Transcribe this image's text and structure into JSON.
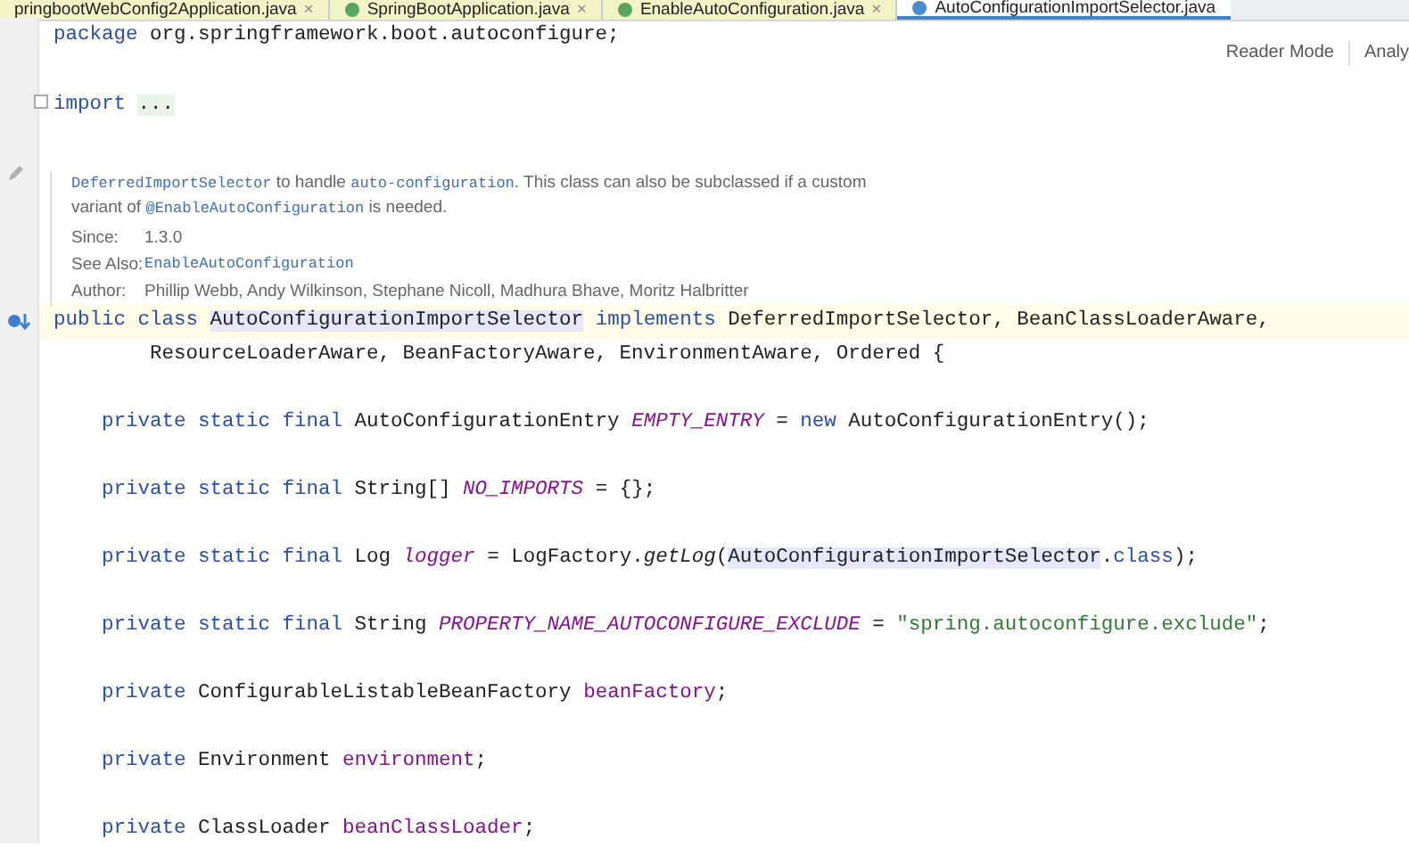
{
  "tabs": [
    {
      "label": "pringbootWebConfig2Application.java",
      "selected": false,
      "close": "×"
    },
    {
      "label": "SpringBootApplication.java",
      "selected": false,
      "close": "×"
    },
    {
      "label": "EnableAutoConfiguration.java",
      "selected": false,
      "close": "×"
    },
    {
      "label": "AutoConfigurationImportSelector.java",
      "selected": true
    }
  ],
  "toolbar": [
    "Reader Mode",
    "Analy"
  ],
  "package_line": [
    {
      "text": "package",
      "kind": "kw"
    },
    {
      "text": " org.springframework.boot.autoconfigure;",
      "kind": "plain"
    }
  ],
  "import_line": [
    {
      "text": "import ",
      "kind": "kw"
    },
    {
      "text": "...",
      "kind": "folded"
    }
  ],
  "javadoc": {
    "summary": [
      {
        "text": "DeferredImportSelector",
        "kind": "code"
      },
      {
        "text": " to handle ",
        "kind": "prose"
      },
      {
        "text": "auto-configuration",
        "kind": "code"
      },
      {
        "text": ". This class can also be subclassed if a custom variant of ",
        "kind": "prose"
      },
      {
        "text": "@EnableAutoConfiguration",
        "kind": "code"
      },
      {
        "text": " is needed.",
        "kind": "prose"
      }
    ],
    "tags": [
      {
        "label": "Since:",
        "value": "1.3.0",
        "kind": "text"
      },
      {
        "label": "See Also:",
        "value": "EnableAutoConfiguration",
        "kind": "link"
      },
      {
        "label": "Author:",
        "value": "Phillip Webb, Andy Wilkinson, Stephane Nicoll, Madhura Bhave, Moritz Halbritter",
        "kind": "text"
      }
    ]
  },
  "class_decl": [
    [
      {
        "text": "public class ",
        "kind": "kw"
      },
      {
        "text": "AutoConfigurationImportSelector",
        "kind": "highlight"
      },
      {
        "text": " implements",
        "kind": "kw"
      },
      {
        "text": " DeferredImportSelector, BeanClassLoaderAware,",
        "kind": "plain"
      }
    ],
    [
      {
        "text": "        ResourceLoaderAware, BeanFactoryAware, EnvironmentAware, Ordered {",
        "kind": "plain"
      }
    ]
  ],
  "fields": [
    [
      {
        "text": "    private static final",
        "kind": "kw"
      },
      {
        "text": " AutoConfigurationEntry ",
        "kind": "plain"
      },
      {
        "text": "EMPTY_ENTRY",
        "kind": "const"
      },
      {
        "text": " = ",
        "kind": "plain"
      },
      {
        "text": "new",
        "kind": "kw"
      },
      {
        "text": " AutoConfigurationEntry();",
        "kind": "plain"
      }
    ],
    [
      {
        "text": "    private static final",
        "kind": "kw"
      },
      {
        "text": " String[] ",
        "kind": "plain"
      },
      {
        "text": "NO_IMPORTS",
        "kind": "const"
      },
      {
        "text": " = {};",
        "kind": "plain"
      }
    ],
    [
      {
        "text": "    private static final",
        "kind": "kw"
      },
      {
        "text": " Log ",
        "kind": "plain"
      },
      {
        "text": "logger",
        "kind": "const"
      },
      {
        "text": " = LogFactory.",
        "kind": "plain"
      },
      {
        "text": "getLog",
        "kind": "method"
      },
      {
        "text": "(",
        "kind": "plain"
      },
      {
        "text": "AutoConfigurationImportSelector",
        "kind": "highlight"
      },
      {
        "text": ".",
        "kind": "plain"
      },
      {
        "text": "class",
        "kind": "kw"
      },
      {
        "text": ");",
        "kind": "plain"
      }
    ],
    [
      {
        "text": "    private static final",
        "kind": "kw"
      },
      {
        "text": " String ",
        "kind": "plain"
      },
      {
        "text": "PROPERTY_NAME_AUTOCONFIGURE_EXCLUDE",
        "kind": "const"
      },
      {
        "text": " = ",
        "kind": "plain"
      },
      {
        "text": "\"spring.autoconfigure.exclude\"",
        "kind": "string"
      },
      {
        "text": ";",
        "kind": "plain"
      }
    ],
    [
      {
        "text": "    private",
        "kind": "kw"
      },
      {
        "text": " ConfigurableListableBeanFactory ",
        "kind": "plain"
      },
      {
        "text": "beanFactory",
        "kind": "field"
      },
      {
        "text": ";",
        "kind": "plain"
      }
    ],
    [
      {
        "text": "    private",
        "kind": "kw"
      },
      {
        "text": " Environment ",
        "kind": "plain"
      },
      {
        "text": "environment",
        "kind": "field"
      },
      {
        "text": ";",
        "kind": "plain"
      }
    ],
    [
      {
        "text": "    private",
        "kind": "kw"
      },
      {
        "text": " ClassLoader ",
        "kind": "plain"
      },
      {
        "text": "beanClassLoader",
        "kind": "field"
      },
      {
        "text": ";",
        "kind": "plain"
      }
    ]
  ]
}
